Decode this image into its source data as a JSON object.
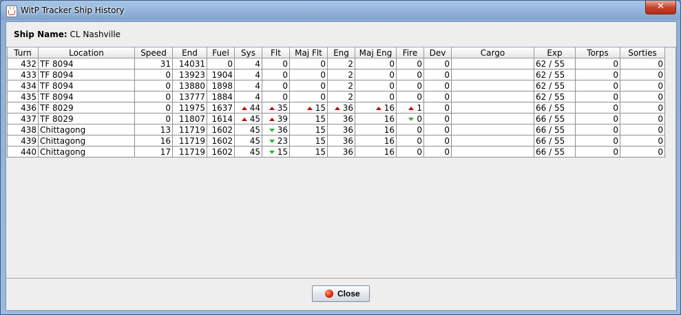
{
  "window": {
    "title": "WitP Tracker Ship History",
    "close_glyph": "✕"
  },
  "ship": {
    "label": "Ship Name:",
    "value": "CL Nashville"
  },
  "table": {
    "columns": [
      "Turn",
      "Location",
      "Speed",
      "End",
      "Fuel",
      "Sys",
      "Flt",
      "Maj Flt",
      "Eng",
      "Maj Eng",
      "Fire",
      "Dev",
      "Cargo",
      "Exp",
      "Torps",
      "Sorties"
    ],
    "rows": [
      {
        "turn": "432",
        "location": "TF 8094",
        "speed": "31",
        "end": "14031",
        "fuel": "0",
        "sys": "4",
        "sys_trend": "",
        "flt": "0",
        "flt_trend": "",
        "majflt": "0",
        "majflt_trend": "",
        "eng": "2",
        "eng_trend": "",
        "majeng": "0",
        "majeng_trend": "",
        "fire": "0",
        "fire_trend": "",
        "dev": "0",
        "cargo": "",
        "exp": "62 / 55",
        "torps": "0",
        "sorties": "0"
      },
      {
        "turn": "433",
        "location": "TF 8094",
        "speed": "0",
        "end": "13923",
        "fuel": "1904",
        "sys": "4",
        "sys_trend": "",
        "flt": "0",
        "flt_trend": "",
        "majflt": "0",
        "majflt_trend": "",
        "eng": "2",
        "eng_trend": "",
        "majeng": "0",
        "majeng_trend": "",
        "fire": "0",
        "fire_trend": "",
        "dev": "0",
        "cargo": "",
        "exp": "62 / 55",
        "torps": "0",
        "sorties": "0"
      },
      {
        "turn": "434",
        "location": "TF 8094",
        "speed": "0",
        "end": "13880",
        "fuel": "1898",
        "sys": "4",
        "sys_trend": "",
        "flt": "0",
        "flt_trend": "",
        "majflt": "0",
        "majflt_trend": "",
        "eng": "2",
        "eng_trend": "",
        "majeng": "0",
        "majeng_trend": "",
        "fire": "0",
        "fire_trend": "",
        "dev": "0",
        "cargo": "",
        "exp": "62 / 55",
        "torps": "0",
        "sorties": "0"
      },
      {
        "turn": "435",
        "location": "TF 8094",
        "speed": "0",
        "end": "13777",
        "fuel": "1884",
        "sys": "4",
        "sys_trend": "",
        "flt": "0",
        "flt_trend": "",
        "majflt": "0",
        "majflt_trend": "",
        "eng": "2",
        "eng_trend": "",
        "majeng": "0",
        "majeng_trend": "",
        "fire": "0",
        "fire_trend": "",
        "dev": "0",
        "cargo": "",
        "exp": "62 / 55",
        "torps": "0",
        "sorties": "0"
      },
      {
        "turn": "436",
        "location": "TF 8029",
        "speed": "0",
        "end": "11975",
        "fuel": "1637",
        "sys": "44",
        "sys_trend": "up",
        "flt": "35",
        "flt_trend": "up",
        "majflt": "15",
        "majflt_trend": "up",
        "eng": "36",
        "eng_trend": "up",
        "majeng": "16",
        "majeng_trend": "up",
        "fire": "1",
        "fire_trend": "up",
        "dev": "0",
        "cargo": "",
        "exp": "66 / 55",
        "torps": "0",
        "sorties": "0"
      },
      {
        "turn": "437",
        "location": "TF 8029",
        "speed": "0",
        "end": "11807",
        "fuel": "1614",
        "sys": "45",
        "sys_trend": "up",
        "flt": "39",
        "flt_trend": "up",
        "majflt": "15",
        "majflt_trend": "",
        "eng": "36",
        "eng_trend": "",
        "majeng": "16",
        "majeng_trend": "",
        "fire": "0",
        "fire_trend": "down",
        "dev": "0",
        "cargo": "",
        "exp": "66 / 55",
        "torps": "0",
        "sorties": "0"
      },
      {
        "turn": "438",
        "location": "Chittagong",
        "speed": "13",
        "end": "11719",
        "fuel": "1602",
        "sys": "45",
        "sys_trend": "",
        "flt": "36",
        "flt_trend": "down",
        "majflt": "15",
        "majflt_trend": "",
        "eng": "36",
        "eng_trend": "",
        "majeng": "16",
        "majeng_trend": "",
        "fire": "0",
        "fire_trend": "",
        "dev": "0",
        "cargo": "",
        "exp": "66 / 55",
        "torps": "0",
        "sorties": "0"
      },
      {
        "turn": "439",
        "location": "Chittagong",
        "speed": "16",
        "end": "11719",
        "fuel": "1602",
        "sys": "45",
        "sys_trend": "",
        "flt": "23",
        "flt_trend": "down",
        "majflt": "15",
        "majflt_trend": "",
        "eng": "36",
        "eng_trend": "",
        "majeng": "16",
        "majeng_trend": "",
        "fire": "0",
        "fire_trend": "",
        "dev": "0",
        "cargo": "",
        "exp": "66 / 55",
        "torps": "0",
        "sorties": "0"
      },
      {
        "turn": "440",
        "location": "Chittagong",
        "speed": "17",
        "end": "11719",
        "fuel": "1602",
        "sys": "45",
        "sys_trend": "",
        "flt": "15",
        "flt_trend": "down",
        "majflt": "15",
        "majflt_trend": "",
        "eng": "36",
        "eng_trend": "",
        "majeng": "16",
        "majeng_trend": "",
        "fire": "0",
        "fire_trend": "",
        "dev": "0",
        "cargo": "",
        "exp": "66 / 55",
        "torps": "0",
        "sorties": "0"
      }
    ]
  },
  "footer": {
    "close_label": "Close"
  },
  "colors": {
    "trend_up": "#cc0000",
    "trend_down": "#22bb22"
  }
}
